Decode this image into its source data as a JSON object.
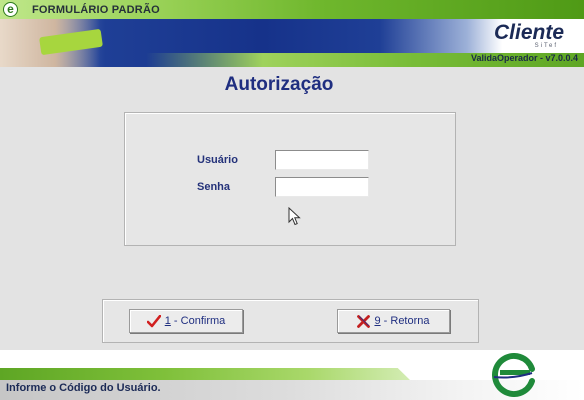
{
  "window": {
    "title": "FORMULÁRIO PADRÃO",
    "title_logo_letter": "e",
    "title_logo_icon": "sitef-e-logo"
  },
  "banner": {
    "brand": "Cliente",
    "brand_sub": "SiTef",
    "version": "ValidaOperador - v7.0.0.4"
  },
  "main": {
    "heading": "Autorização",
    "fields": {
      "usuario": {
        "label": "Usuário",
        "value": "",
        "placeholder": ""
      },
      "senha": {
        "label": "Senha",
        "value": "",
        "placeholder": ""
      }
    }
  },
  "buttons": {
    "confirma": {
      "hotkey": "1",
      "label": " - Confirma",
      "icon": "checkmark-icon"
    },
    "retorna": {
      "hotkey": "9",
      "label": " - Retorna",
      "icon": "x-icon"
    }
  },
  "status": {
    "message": "Informe o Código do Usuário."
  },
  "colors": {
    "heading": "#1f2e80",
    "green_accent": "#6fb72d",
    "navy_band": "#16328a",
    "confirm_icon": "#d12020",
    "cancel_icon": "#c42020",
    "background": "#e3e3e3"
  }
}
